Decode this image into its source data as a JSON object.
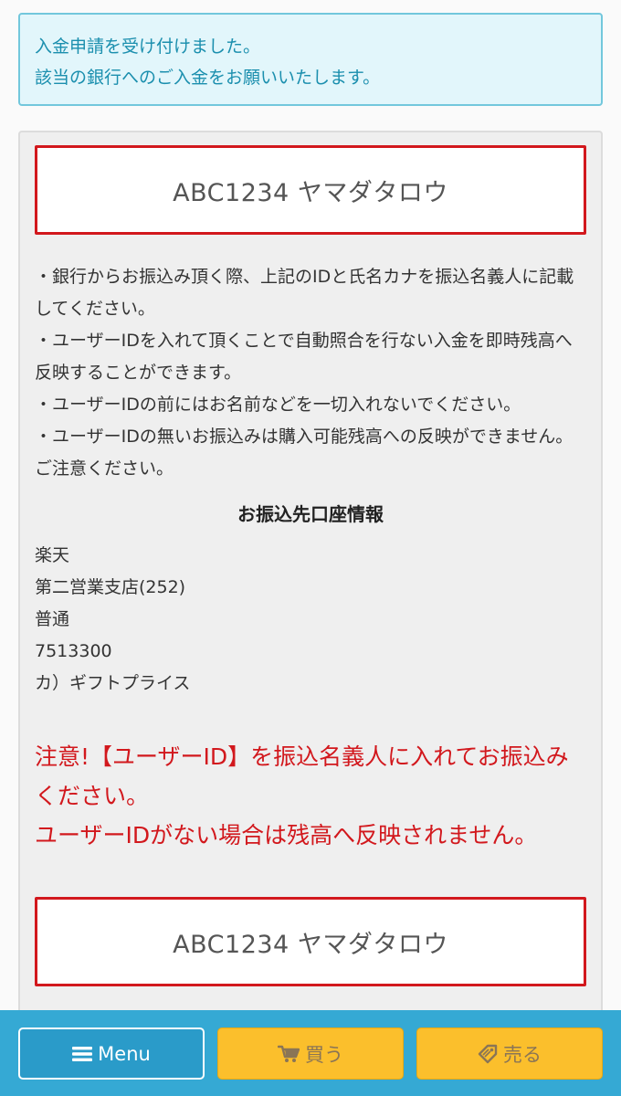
{
  "alert": {
    "lines": [
      "入金申請を受け付けました。",
      "該当の銀行へのご入金をお願いいたします。"
    ]
  },
  "transfer": {
    "id_name_top": "ABC1234 ヤマダタロウ",
    "notes": [
      "・銀行からお振込み頂く際、上記のIDと氏名カナを振込名義人に記載してください。",
      "・ユーザーIDを入れて頂くことで自動照合を行ない入金を即時残高へ反映することができます。",
      "・ユーザーIDの前にはお名前などを一切入れないでください。",
      "・ユーザーIDの無いお振込みは購入可能残高への反映ができません。ご注意ください。"
    ],
    "section_title": "お振込先口座情報",
    "account": {
      "bank": "楽天",
      "branch": "第二営業支店(252)",
      "type": "普通",
      "number": "7513300",
      "holder": "カ）ギフトプライス"
    },
    "warning": {
      "line1": "注意!【ユーザーID】を振込名義人に入れてお振込みください。",
      "line2": "ユーザーIDがない場合は残高へ反映されません。"
    },
    "id_name_bottom": "ABC1234 ヤマダタロウ"
  },
  "bottom_nav": {
    "menu": {
      "label": "Menu",
      "icon": "hamburger-icon"
    },
    "buy": {
      "label": "買う",
      "icon": "cart-icon"
    },
    "sell": {
      "label": "売る",
      "icon": "tag-icon"
    }
  },
  "colors": {
    "alert_text": "#1b8fae",
    "alert_bg": "#e2f6fb",
    "alert_border": "#72c7dc",
    "id_box_border": "#d2181d",
    "warning_text": "#d2181d",
    "bottom_bar": "#35a9d4",
    "menu_button": "#2a9bc9",
    "action_button": "#fbbf2c"
  }
}
